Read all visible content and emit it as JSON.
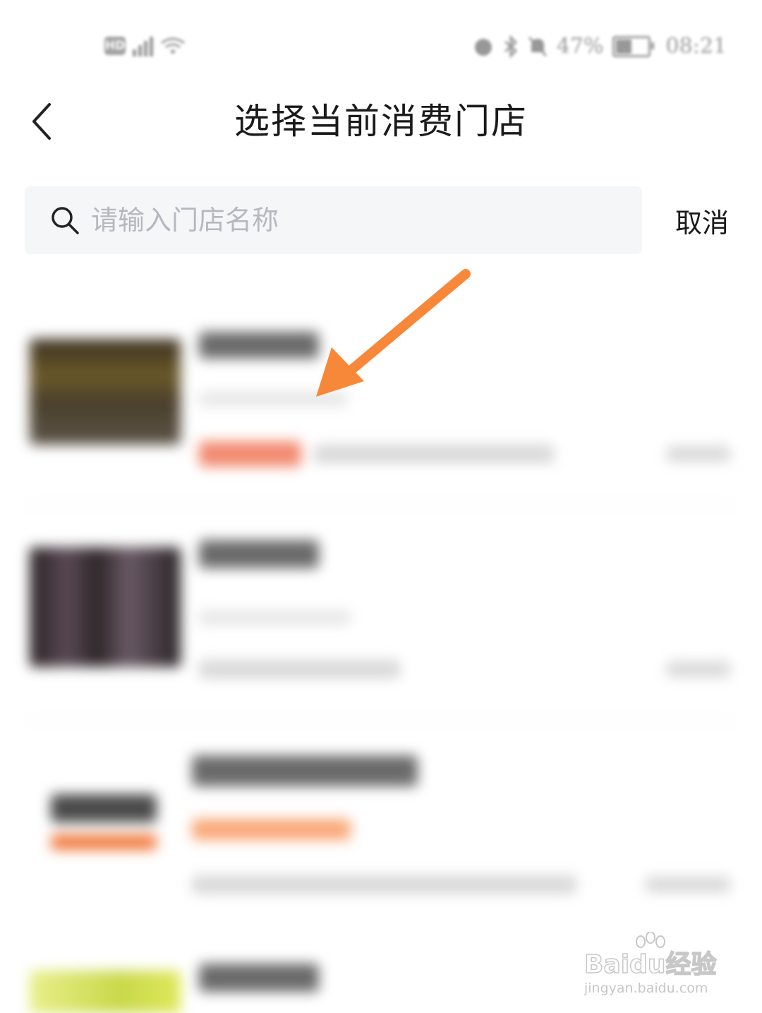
{
  "status_bar": {
    "hd": "HD",
    "network": "4G",
    "battery_percent": "47%",
    "time": "08:21"
  },
  "header": {
    "title": "选择当前消费门店"
  },
  "search": {
    "placeholder": "请输入门店名称",
    "cancel_label": "取消"
  },
  "watermark": {
    "brand": "Baidu经验",
    "url": "jingyan.baidu.com"
  },
  "colors": {
    "accent_orange": "#f7883a",
    "search_bg": "#f5f6f8",
    "placeholder": "#b5b8bf"
  }
}
